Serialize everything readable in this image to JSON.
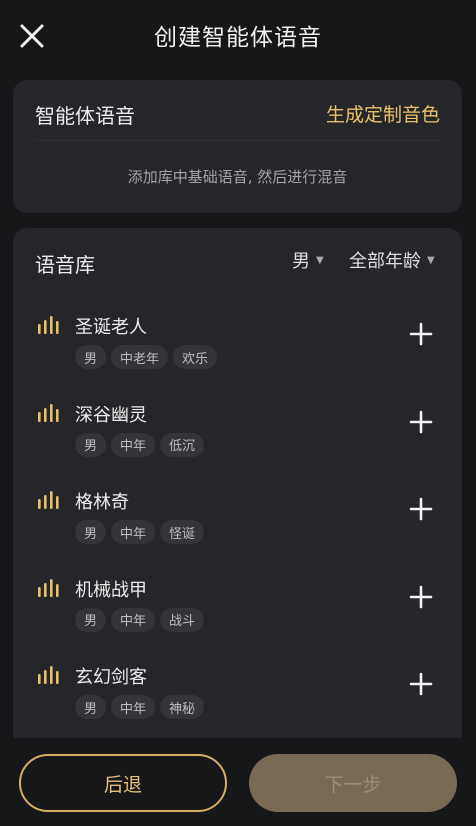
{
  "header": {
    "title": "创建智能体语音",
    "close_icon": "close-icon"
  },
  "voice_card": {
    "title": "智能体语音",
    "custom_link": "生成定制音色",
    "hint": "添加库中基础语音, 然后进行混音"
  },
  "library": {
    "title": "语音库",
    "filter_gender": "男",
    "filter_age": "全部年龄",
    "items": [
      {
        "name": "圣诞老人",
        "tags": [
          "男",
          "中老年",
          "欢乐"
        ]
      },
      {
        "name": "深谷幽灵",
        "tags": [
          "男",
          "中年",
          "低沉"
        ]
      },
      {
        "name": "格林奇",
        "tags": [
          "男",
          "中年",
          "怪诞"
        ]
      },
      {
        "name": "机械战甲",
        "tags": [
          "男",
          "中年",
          "战斗"
        ]
      },
      {
        "name": "玄幻剑客",
        "tags": [
          "男",
          "中年",
          "神秘"
        ]
      }
    ]
  },
  "footer": {
    "back_label": "后退",
    "next_label": "下一步"
  },
  "colors": {
    "accent": "#e9c06a",
    "background": "#161719",
    "card": "#25262a",
    "tag_bg": "#34353a",
    "next_bg": "#786a54"
  }
}
